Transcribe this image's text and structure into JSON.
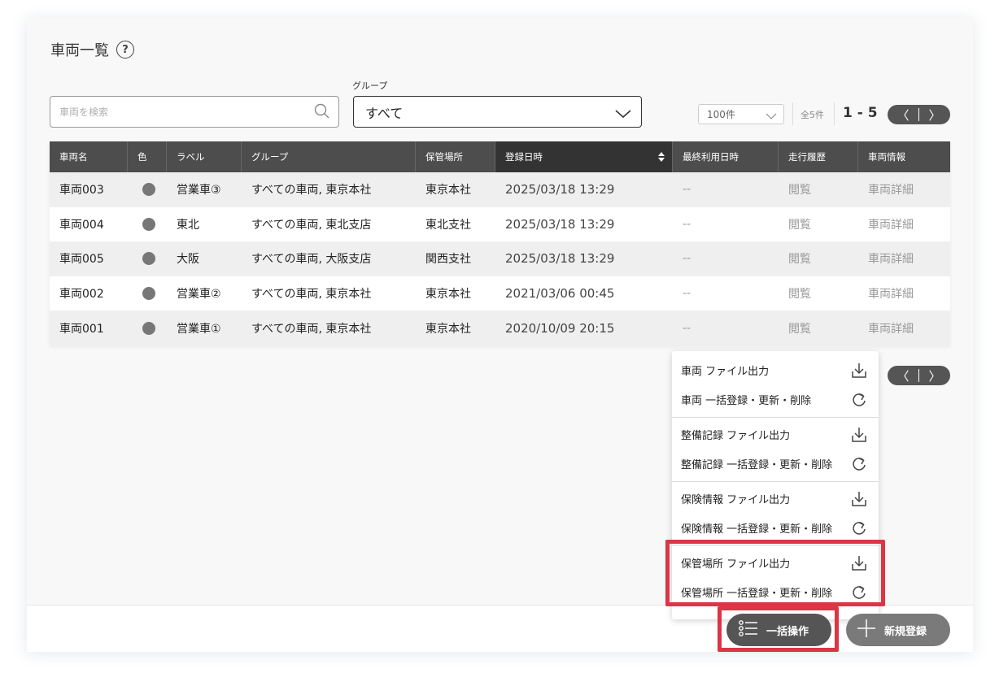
{
  "header": {
    "title": "車両一覧"
  },
  "search": {
    "placeholder": "車両を検索"
  },
  "group_filter": {
    "label": "グループ",
    "value": "すべて"
  },
  "pagination": {
    "per_page": "100件",
    "total": "全5件",
    "range": "1 - 5",
    "prev": "〈",
    "next": "〉"
  },
  "table": {
    "columns": [
      "車両名",
      "色",
      "ラベル",
      "グループ",
      "保管場所",
      "登録日時",
      "最終利用日時",
      "走行履歴",
      "車両情報"
    ],
    "rows": [
      {
        "name": "車両003",
        "color": "#777777",
        "label": "営業車③",
        "group": "すべての車両, 東京本社",
        "location": "東京本社",
        "registered": "2025/03/18 13:29",
        "last_used": "--",
        "history": "閲覧",
        "info": "車両詳細"
      },
      {
        "name": "車両004",
        "color": "#777777",
        "label": "東北",
        "group": "すべての車両, 東北支店",
        "location": "東北支社",
        "registered": "2025/03/18 13:29",
        "last_used": "--",
        "history": "閲覧",
        "info": "車両詳細"
      },
      {
        "name": "車両005",
        "color": "#777777",
        "label": "大阪",
        "group": "すべての車両, 大阪支店",
        "location": "関西支社",
        "registered": "2025/03/18 13:29",
        "last_used": "--",
        "history": "閲覧",
        "info": "車両詳細"
      },
      {
        "name": "車両002",
        "color": "#777777",
        "label": "営業車②",
        "group": "すべての車両, 東京本社",
        "location": "東京本社",
        "registered": "2021/03/06 00:45",
        "last_used": "--",
        "history": "閲覧",
        "info": "車両詳細"
      },
      {
        "name": "車両001",
        "color": "#777777",
        "label": "営業車①",
        "group": "すべての車両, 東京本社",
        "location": "東京本社",
        "registered": "2020/10/09 20:15",
        "last_used": "--",
        "history": "閲覧",
        "info": "車両詳細"
      }
    ]
  },
  "bulk_menu": {
    "items": [
      {
        "label": "車両 ファイル出力",
        "icon": "download-icon"
      },
      {
        "label": "車両 一括登録・更新・削除",
        "icon": "refresh-icon"
      },
      {
        "label": "整備記録 ファイル出力",
        "icon": "download-icon"
      },
      {
        "label": "整備記録 一括登録・更新・削除",
        "icon": "refresh-icon"
      },
      {
        "label": "保険情報 ファイル出力",
        "icon": "download-icon"
      },
      {
        "label": "保険情報 一括登録・更新・削除",
        "icon": "refresh-icon"
      },
      {
        "label": "保管場所 ファイル出力",
        "icon": "download-icon"
      },
      {
        "label": "保管場所 一括登録・更新・削除",
        "icon": "refresh-icon"
      }
    ]
  },
  "footer": {
    "bulk_label": "一括操作",
    "new_label": "新規登録"
  },
  "colors": {
    "highlight": "#dc3545",
    "header_bg": "#4d4d4d",
    "button_dark": "#555555"
  }
}
